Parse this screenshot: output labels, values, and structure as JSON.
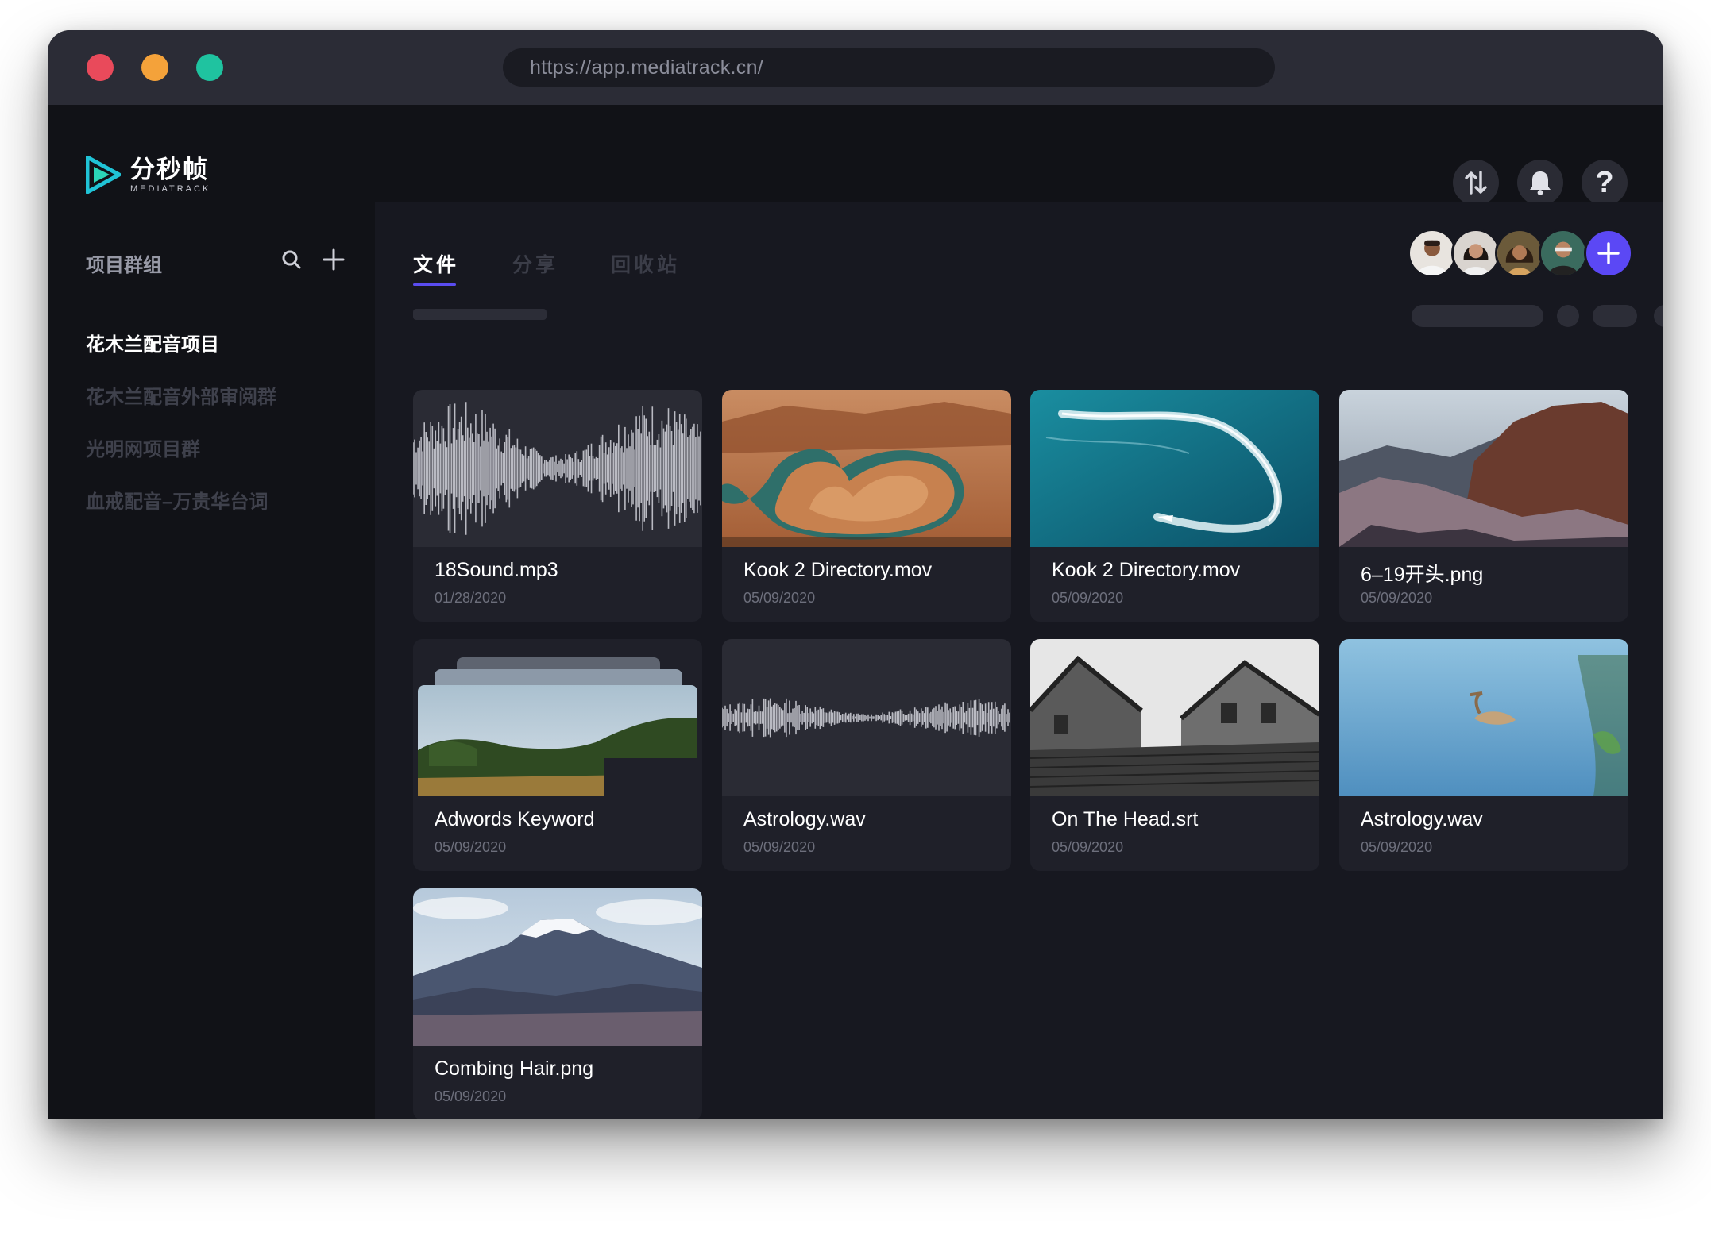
{
  "browser": {
    "url": "https://app.mediatrack.cn/"
  },
  "app": {
    "logo_cn": "分秒帧",
    "logo_en": "MEDIATRACK"
  },
  "sidebar": {
    "heading": "项目群组",
    "items": [
      {
        "label": "花木兰配音项目",
        "active": true
      },
      {
        "label": "花木兰配音外部审阅群",
        "active": false
      },
      {
        "label": "光明网项目群",
        "active": false
      },
      {
        "label": "血戒配音–万贵华台词",
        "active": false
      }
    ]
  },
  "tabs": [
    {
      "label": "文件",
      "active": true
    },
    {
      "label": "分享",
      "active": false
    },
    {
      "label": "回收站",
      "active": false
    }
  ],
  "colors": {
    "accent": "#5b48f5",
    "background": "#111217",
    "panel": "#171820",
    "card": "#1f2029"
  },
  "files": [
    {
      "name": "18Sound.mp3",
      "date": "01/28/2020",
      "thumb": "waveform-dense"
    },
    {
      "name": "Kook 2 Directory.mov",
      "date": "05/09/2020",
      "thumb": "canyon-bend"
    },
    {
      "name": "Kook 2 Directory.mov",
      "date": "05/09/2020",
      "thumb": "ocean-boat"
    },
    {
      "name": "6–19开头.png",
      "date": "05/09/2020",
      "thumb": "mountains"
    },
    {
      "name": "Adwords Keyword",
      "date": "05/09/2020",
      "thumb": "folder-stack-landscape"
    },
    {
      "name": "Astrology.wav",
      "date": "05/09/2020",
      "thumb": "waveform-thin"
    },
    {
      "name": "On The Head.srt",
      "date": "05/09/2020",
      "thumb": "old-houses-bw"
    },
    {
      "name": "Astrology.wav",
      "date": "05/09/2020",
      "thumb": "pelican-water"
    },
    {
      "name": "Combing Hair.png",
      "date": "05/09/2020",
      "thumb": "snow-mountain"
    }
  ],
  "icons": {
    "transfer": "transfer-icon",
    "bell": "bell-icon",
    "help": "help-icon",
    "search": "search-icon",
    "add": "plus-icon"
  }
}
